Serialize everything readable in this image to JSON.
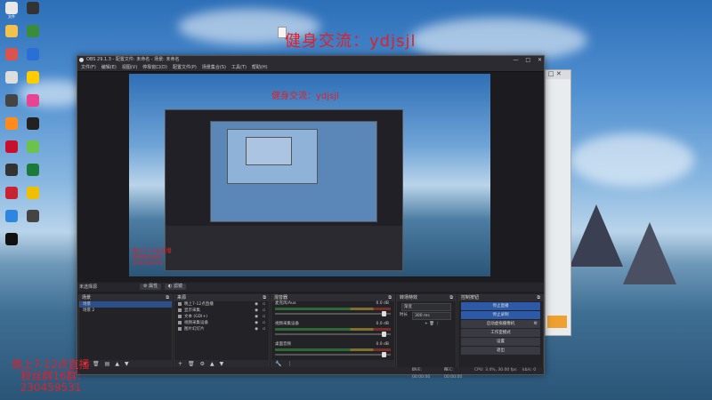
{
  "desktop": {
    "overlay_top": "健身交流：ydjsjl",
    "overlay_bottom_lines": [
      "晚上7-12点直播",
      "粉丝群16群:",
      "230459531"
    ],
    "icons": [
      {
        "name": "file-icon",
        "label": "文件",
        "color": "#e8e8e8"
      },
      {
        "name": "app-icon",
        "label": "",
        "color": "#333"
      },
      {
        "name": "folder-icon",
        "label": "",
        "color": "#f2c14e"
      },
      {
        "name": "app-icon",
        "label": "",
        "color": "#3a8c3a"
      },
      {
        "name": "app-icon",
        "label": "",
        "color": "#d9534f"
      },
      {
        "name": "app-icon",
        "label": "",
        "color": "#2a6fd6"
      },
      {
        "name": "app-icon",
        "label": "",
        "color": "#ddd"
      },
      {
        "name": "app-icon",
        "label": "",
        "color": "#ffcc00"
      },
      {
        "name": "app-icon",
        "label": "",
        "color": "#444"
      },
      {
        "name": "app-icon",
        "label": "",
        "color": "#e84393"
      },
      {
        "name": "app-icon",
        "label": "",
        "color": "#ff8c1a"
      },
      {
        "name": "app-icon",
        "label": "",
        "color": "#222"
      },
      {
        "name": "app-icon",
        "label": "",
        "color": "#c8102e"
      },
      {
        "name": "app-icon",
        "label": "",
        "color": "#6cc24a"
      },
      {
        "name": "app-icon",
        "label": "",
        "color": "#333"
      },
      {
        "name": "app-icon",
        "label": "",
        "color": "#1b7a3a"
      },
      {
        "name": "app-icon",
        "label": "",
        "color": "#c82333"
      },
      {
        "name": "app-icon",
        "label": "",
        "color": "#f0c000"
      },
      {
        "name": "app-icon",
        "label": "",
        "color": "#2e86de"
      },
      {
        "name": "app-icon",
        "label": "",
        "color": "#444"
      },
      {
        "name": "app-icon",
        "label": "",
        "color": "#111"
      }
    ]
  },
  "obs": {
    "title": "OBS 29.1.3 - 配置文件: 未命名 - 场景: 未命名",
    "menu": [
      "文件(F)",
      "编辑(E)",
      "视图(V)",
      "停靠窗口(D)",
      "配置文件(P)",
      "场景集合(S)",
      "工具(T)",
      "帮助(H)"
    ],
    "preview_overlay": "健身交流：ydjsjl",
    "preview_overlay_bl": [
      "晚上7-12点直播",
      "粉丝群16群:",
      "230459531"
    ],
    "scene_bar": {
      "current": "未选择源",
      "properties": "属性",
      "filters": "滤镜"
    },
    "docks": {
      "scenes": {
        "title": "场景",
        "items": [
          "场景",
          "场景 2"
        ],
        "selected": 0
      },
      "sources": {
        "title": "来源",
        "items": [
          "晚上7-12点直播",
          "显示采集",
          "文本 (GDI+)",
          "视频采集设备",
          "图片幻灯片"
        ]
      },
      "mixer": {
        "title": "混音器",
        "channels": [
          {
            "name": "麦克风/Aux",
            "db": "0.0 dB",
            "level": 0.92
          },
          {
            "name": "视频采集设备",
            "db": "0.0 dB",
            "level": 0.92
          },
          {
            "name": "桌面音频",
            "db": "0.0 dB",
            "level": 0.92
          }
        ]
      },
      "transitions": {
        "title": "转场特效",
        "type": "渐变",
        "duration_label": "时长",
        "duration": "300 ms"
      },
      "controls": {
        "title": "控制按钮",
        "buttons": [
          "停止直播",
          "停止录制",
          "启动虚拟摄像机",
          "工作室模式",
          "设置",
          "退出"
        ]
      }
    },
    "status": {
      "live": "LIVE: 00:00:00",
      "rec": "REC: 00:00:00",
      "cpu": "CPU: 3.4%, 30.00 fps",
      "kbps": "kb/s: 0"
    }
  }
}
